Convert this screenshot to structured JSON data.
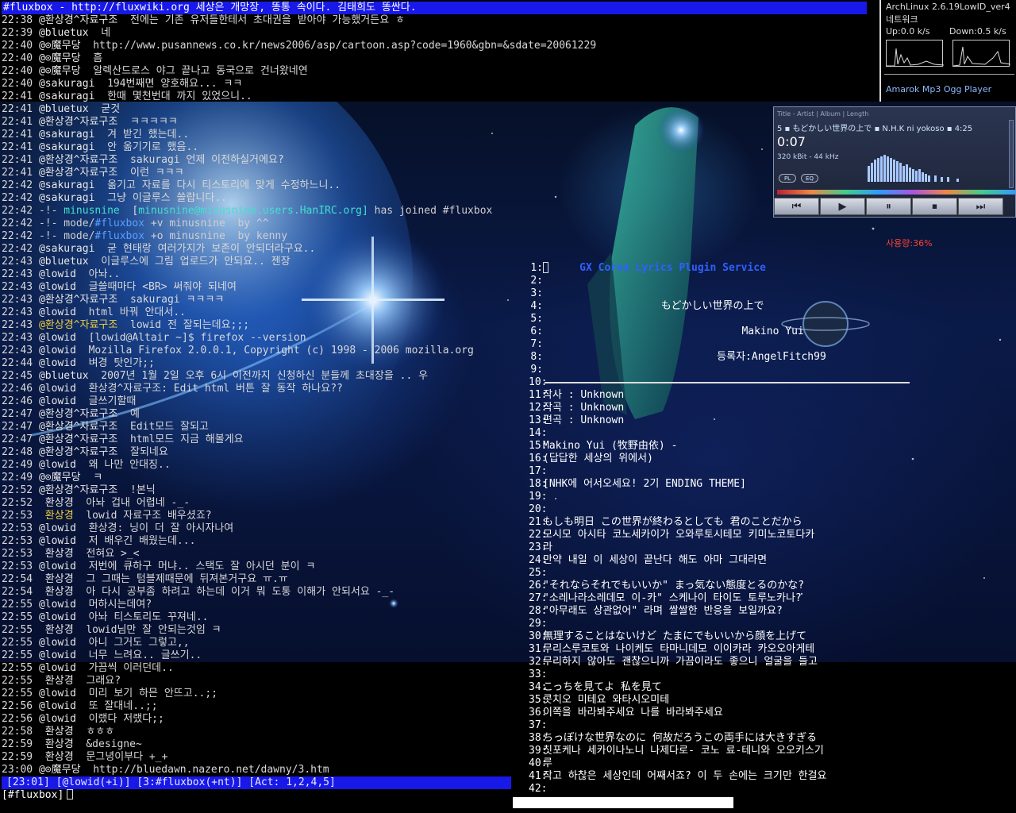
{
  "irc": {
    "title": "#fluxbox - http://fluxwiki.org 세상은 개망장, 똥통 속이다. 김태희도 똥싼다.",
    "lines": [
      {
        "t": "22:38",
        "n": "@환상경^자료구조",
        "m": "전에는 기존 유저들한테서 초대권을 받아야 가능했거든요 ㅎ"
      },
      {
        "t": "22:39",
        "n": "@bluetux",
        "m": "네"
      },
      {
        "t": "22:40",
        "n": "@⊙魔무당",
        "m": "http://www.pusannews.co.kr/news2006/asp/cartoon.asp?code=1960&gbn=&sdate=20061229"
      },
      {
        "t": "22:40",
        "n": "@⊙魔무당",
        "m": "흠"
      },
      {
        "t": "22:40",
        "n": "@⊙魔무당",
        "m": "알렉산드로스 야그 끝나고 동국으로 건너왔네연"
      },
      {
        "t": "22:40",
        "n": "@sakuragi",
        "m": "194번째면 양호해요... ㅋㅋ"
      },
      {
        "t": "22:41",
        "n": "@sakuragi",
        "m": "한때 몇천번대 까지 있었으니.."
      },
      {
        "t": "22:41",
        "n": "@bluetux",
        "m": "굳것"
      },
      {
        "t": "22:41",
        "n": "@환상경^자료구조",
        "m": "ㅋㅋㅋㅋㅋ"
      },
      {
        "t": "22:41",
        "n": "@sakuragi",
        "m": "겨 받긴 했는데.."
      },
      {
        "t": "22:41",
        "n": "@sakuragi",
        "m": "안 옮기기로 했음.."
      },
      {
        "t": "22:41",
        "n": "@환상경^자료구조",
        "m": "sakuragi 언제 이전하실거에요?"
      },
      {
        "t": "22:41",
        "n": "@환상경^자료구조",
        "m": "이런 ㅋㅋㅋ"
      },
      {
        "t": "22:42",
        "n": "@sakuragi",
        "m": "옮기고 자료를 다시 티스토리에 맞게 수정하느니.."
      },
      {
        "t": "22:42",
        "n": "@sakuragi",
        "m": "그냥 이글루스 쓸랍니다.."
      },
      {
        "t": "22:42",
        "kind": "join",
        "n": "minusnine",
        "host": "minusnine@minusnine.users.HanIRC.org]",
        "m": "has joined",
        "chan": "#fluxbox"
      },
      {
        "t": "22:42",
        "kind": "mode",
        "chan": "#fluxbox",
        "m": "+v minusnine  by ^^"
      },
      {
        "t": "22:42",
        "kind": "mode",
        "chan": "#fluxbox",
        "m": "+o minusnine  by kenny"
      },
      {
        "t": "22:42",
        "n": "@sakuragi",
        "m": "굳 현태랑 여러가지가 보존이 안되더라구요.."
      },
      {
        "t": "22:43",
        "n": "@bluetux",
        "m": "이글루스에 그림 업로드가 안되요.. 젠장"
      },
      {
        "t": "22:43",
        "n": "@lowid",
        "m": "아놔.."
      },
      {
        "t": "22:43",
        "n": "@lowid",
        "m": "글쓸때마다 <BR> 써줘야 되네여"
      },
      {
        "t": "22:43",
        "n": "@환상경^자료구조",
        "m": "sakuragi ㅋㅋㅋㅋ"
      },
      {
        "t": "22:43",
        "n": "@lowid",
        "m": "html 바꿔 안대서.."
      },
      {
        "t": "22:43",
        "n": "@환상경^자료구조",
        "m": "lowid 전 잘되는데요;;;",
        "y": true
      },
      {
        "t": "22:43",
        "n": "@lowid",
        "m": "[lowid@Altair ~]$ firefox --version"
      },
      {
        "t": "22:43",
        "n": "@lowid",
        "m": "Mozilla Firefox 2.0.0.1, Copyright (c) 1998 - 2006 mozilla.org"
      },
      {
        "t": "22:44",
        "n": "@lowid",
        "m": "벼경 탓인가;;"
      },
      {
        "t": "22:45",
        "n": "@bluetux",
        "m": "2007년 1월 2일 오후 6시 이전까지 신청하신 분들께 초대장을 .. 우"
      },
      {
        "t": "22:46",
        "n": "@lowid",
        "m": "환상경^자료구조: Edit html 버튼 잘 동작 하나요??"
      },
      {
        "t": "22:46",
        "n": "@lowid",
        "m": "글쓰기할때"
      },
      {
        "t": "22:47",
        "n": "@환상경^자료구조",
        "m": "예"
      },
      {
        "t": "22:47",
        "n": "@환상경^자료구조",
        "m": "Edit모드 잘되고"
      },
      {
        "t": "22:47",
        "n": "@환상경^자료구조",
        "m": "html모드 지금 해볼게요"
      },
      {
        "t": "22:48",
        "n": "@환상경^자료구조",
        "m": "잘되네요"
      },
      {
        "t": "22:49",
        "n": "@lowid",
        "m": "왜 나만 안대징.."
      },
      {
        "t": "22:49",
        "n": "@⊙魔무당",
        "m": "ㅋ"
      },
      {
        "t": "22:52",
        "n": "@환상경^자료구조",
        "m": "!본닉"
      },
      {
        "t": "22:52",
        "n": " 환상경",
        "m": "아놔 겁내 어렵네 -_-"
      },
      {
        "t": "22:53",
        "n": " 환상경",
        "m": "lowid 자료구조 배우셨죠?",
        "y": true
      },
      {
        "t": "22:53",
        "n": "@lowid",
        "m": "환상경: 닝이 더 잘 아시자나여"
      },
      {
        "t": "22:53",
        "n": "@lowid",
        "m": "저 배우긴 배웠는데..."
      },
      {
        "t": "22:53",
        "n": " 환상경",
        "m": "전혀요 >_<"
      },
      {
        "t": "22:53",
        "n": "@lowid",
        "m": "저번에 큐하구 머냐.. 스택도 잘 아시던 분이 ㅋ"
      },
      {
        "t": "22:54",
        "n": " 환상경",
        "m": "그 그때는 텀블제때문에 뒤져본거구요 ㅠ.ㅠ"
      },
      {
        "t": "22:54",
        "n": " 환상경",
        "m": "아 다시 공부좀 하려고 하는데 이거 뭐 도통 이해가 안되서요 -_-"
      },
      {
        "t": "22:55",
        "n": "@lowid",
        "m": "머하시는데여?"
      },
      {
        "t": "22:55",
        "n": "@lowid",
        "m": "아놔 티스토리도 꾸져네.."
      },
      {
        "t": "22:55",
        "n": " 환상경",
        "m": "lowid님만 잘 안되는것임 ㅋ"
      },
      {
        "t": "22:55",
        "n": "@lowid",
        "m": "아니 그거도 그렇고,,"
      },
      {
        "t": "22:55",
        "n": "@lowid",
        "m": "너무 느려요.. 글쓰기.."
      },
      {
        "t": "22:55",
        "n": "@lowid",
        "m": "가끔씩 이러던데.."
      },
      {
        "t": "22:55",
        "n": " 환상경",
        "m": "그래요?"
      },
      {
        "t": "22:55",
        "n": "@lowid",
        "m": "미리 보기 하믄 안뜨고..;;"
      },
      {
        "t": "22:56",
        "n": "@lowid",
        "m": "또 잘대네..;;"
      },
      {
        "t": "22:56",
        "n": "@lowid",
        "m": "이랬다 저랬다;;"
      },
      {
        "t": "22:58",
        "n": " 환상경",
        "m": "ㅎㅎㅎ"
      },
      {
        "t": "22:59",
        "n": " 환상경",
        "m": "&designe~"
      },
      {
        "t": "22:59",
        "n": " 환상경",
        "m": "문그녕이부다 +_+"
      },
      {
        "t": "23:00",
        "n": "@⊙魔무당",
        "m": "http://bluedawn.nazero.net/dawny/3.htm"
      }
    ],
    "status": "[23:01] [@lowid(+i)] [3:#fluxbox(+nt)] [Act: 1,2,4,5]",
    "input_prompt": "[#fluxbox]"
  },
  "lyrics": {
    "service_title": "GX Corea Lyrics Plugin Service",
    "song_title": "もどかしい世界の上で",
    "artist": "Makino Yui",
    "registrant": "등록자:AngelFitch99",
    "lines": [
      "",
      "",
      "",
      "",
      "",
      "",
      "",
      "",
      "",
      "",
      "작사 : Unknown",
      "작곡 : Unknown",
      "편곡 : Unknown",
      "",
      "Makino Yui (牧野由依) -",
      "(답답한 세상의 위에서)",
      "",
      "[NHK에 어서오세요! 2기 ENDING THEME]",
      "",
      "",
      "もしも明日 この世界が終わるとしても 君のことだから",
      "모시모 아시타 코노세카이가 오와루토시테모 키미노코토다카",
      "라",
      "만약 내일 이 세상이 끝난다 해도 아마 그대라면",
      "",
      "\"それならそれでもいいか\" まっ気ない態度とるのかな?",
      "\"소레나라소레데모 이-카\" 스케나이 타이도 토루노카나?",
      "\"아무래도 상관없어\" 라며 쌀쌀한 반응을 보일까요?",
      "",
      "無理することはないけど たまにでもいいから顔を上げて",
      "무리스루코토와 나이케도 타마니데모 이이카라 카오오아게테",
      "무리하지 않아도 괜찮으니까 가끔이라도 좋으니 얼굴을 들고",
      "",
      "こっちを見てよ 私を見て",
      "콧치오 미테요 와타시오미테",
      "이쪽을 바라봐주세요 나를 바라봐주세요",
      "",
      "ちっぽけな世界なのに 何故だろうこの両手には大きすぎる",
      "칫포케나 세카이나노니 나제다로- 코노 료-테니와 오오키스기",
      "루",
      "작고 하찮은 세상인데 어째서죠? 이 두 손에는 크기만 한걸요",
      ""
    ]
  },
  "sysmon": {
    "title": "ArchLinux 2.6.19LowID_ver4",
    "net_label": "네트워크",
    "up": "Up:0.0 k/s",
    "down": "Down:0.5 k/s",
    "player_label": "Amarok Mp3 Ogg Player"
  },
  "player": {
    "header": "Title - Artist | Album | Length",
    "track": "5 ▪ もどかしい世界の上で ▪ N.H.K ni yokoso ▪ 4:25",
    "time": "0:07",
    "rate": "320 kBit - 44 kHz",
    "pl_label": "PL",
    "eq_label": "EQ",
    "buttons": [
      "⏮",
      "▶",
      "⏸",
      "⏹",
      "⏭"
    ]
  },
  "usage_label": "사용량:36%",
  "colors": {
    "title_bar": "#1818e8",
    "join": "#40e0d0",
    "highlight_nick": "#f0d040",
    "lyrics_title": "#3060ff",
    "usage": "#ff4030"
  }
}
